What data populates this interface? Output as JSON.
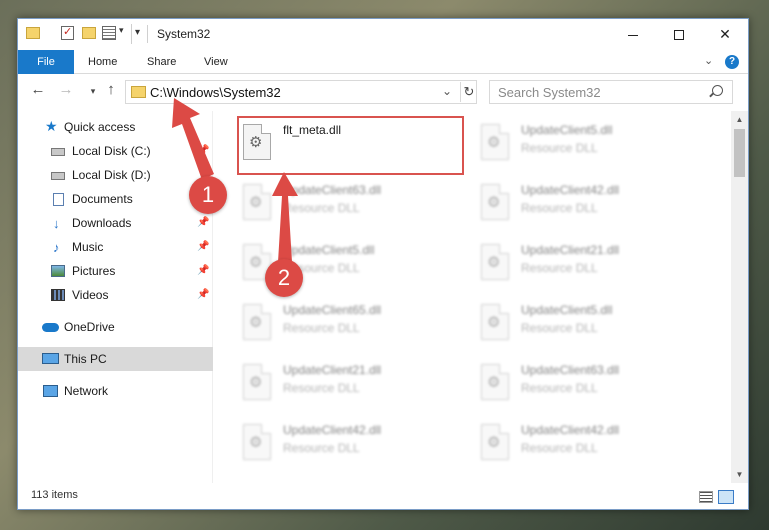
{
  "window": {
    "title": "System32",
    "controls": {
      "minimize_icon": "minimize-icon",
      "maximize_icon": "maximize-icon",
      "close_symbol": "✕"
    }
  },
  "ribbon": {
    "tabs": [
      {
        "label": "File",
        "active": true
      },
      {
        "label": "Home"
      },
      {
        "label": "Share"
      },
      {
        "label": "View"
      }
    ],
    "expand_symbol": "⌄",
    "help_symbol": "?"
  },
  "navigation": {
    "back_symbol": "←",
    "forward_symbol": "→",
    "recent_symbol": "▾",
    "up_symbol": "↑",
    "address": "C:\\Windows\\System32",
    "address_dropdown_symbol": "⌄",
    "refresh_symbol": "↻",
    "search_placeholder": "Search System32"
  },
  "sidebar": {
    "items": [
      {
        "label": "Quick access",
        "icon": "star-icon"
      },
      {
        "label": "Local Disk (C:)",
        "icon": "drive-icon",
        "pinned": true
      },
      {
        "label": "Local Disk (D:)",
        "icon": "drive-icon",
        "pinned": false
      },
      {
        "label": "Documents",
        "icon": "document-icon",
        "pinned": true
      },
      {
        "label": "Downloads",
        "icon": "download-icon",
        "pinned": true
      },
      {
        "label": "Music",
        "icon": "music-icon",
        "pinned": true
      },
      {
        "label": "Pictures",
        "icon": "pictures-icon",
        "pinned": true
      },
      {
        "label": "Videos",
        "icon": "videos-icon",
        "pinned": true
      },
      {
        "label": "OneDrive",
        "icon": "onedrive-icon"
      },
      {
        "label": "This PC",
        "icon": "computer-icon",
        "selected": true
      },
      {
        "label": "Network",
        "icon": "network-icon"
      }
    ],
    "pin_symbol": "📌"
  },
  "files": {
    "highlighted": {
      "name": "flt_meta.dll",
      "type": ""
    },
    "column1": [
      {
        "name": "UpdateClient63.dll",
        "type": "Resource DLL"
      },
      {
        "name": "UpdateClient5.dll",
        "type": "Resource DLL"
      },
      {
        "name": "UpdateClient65.dll",
        "type": "Resource DLL"
      },
      {
        "name": "UpdateClient21.dll",
        "type": "Resource DLL"
      },
      {
        "name": "UpdateClient42.dll",
        "type": "Resource DLL"
      }
    ],
    "column2": [
      {
        "name": "UpdateClient5.dll",
        "type": "Resource DLL"
      },
      {
        "name": "UpdateClient42.dll",
        "type": "Resource DLL"
      },
      {
        "name": "UpdateClient21.dll",
        "type": "Resource DLL"
      },
      {
        "name": "UpdateClient5.dll",
        "type": "Resource DLL"
      },
      {
        "name": "UpdateClient63.dll",
        "type": "Resource DLL"
      },
      {
        "name": "UpdateClient42.dll",
        "type": "Resource DLL"
      }
    ]
  },
  "status": {
    "item_count": "113 items"
  },
  "annotations": {
    "color": "#dc4a45",
    "step1": "1",
    "step2": "2"
  },
  "scrollbar": {
    "up_symbol": "▲",
    "down_symbol": "▼"
  }
}
